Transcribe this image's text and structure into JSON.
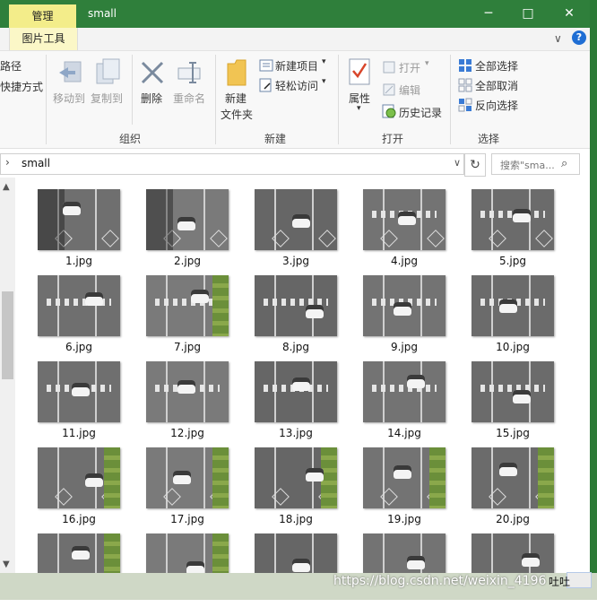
{
  "window": {
    "context_tab": "管理",
    "title": "small",
    "minimize_glyph": "─",
    "maximize_glyph": "□",
    "close_glyph": "✕"
  },
  "tabs": {
    "picture_tools": "图片工具",
    "collapse_glyph": "∨",
    "help_glyph": "?"
  },
  "ribbon": {
    "clipboard_partial": [
      "路径",
      "快捷方式"
    ],
    "organize": {
      "move_to": "移动到",
      "copy_to": "复制到",
      "delete": "删除",
      "rename": "重命名",
      "group_label": "组织"
    },
    "new": {
      "new_folder_line1": "新建",
      "new_folder_line2": "文件夹",
      "new_item": "新建项目",
      "easy_access": "轻松访问",
      "group_label": "新建"
    },
    "open": {
      "properties": "属性",
      "open": "打开",
      "edit": "编辑",
      "history": "历史记录",
      "group_label": "打开"
    },
    "select": {
      "select_all": "全部选择",
      "select_none": "全部取消",
      "invert": "反向选择",
      "group_label": "选择"
    }
  },
  "address": {
    "path": "small",
    "search_placeholder": "搜索\"sma...",
    "refresh_glyph": "↻",
    "search_glyph": "🔍"
  },
  "files": [
    {
      "name": "1.jpg"
    },
    {
      "name": "2.jpg"
    },
    {
      "name": "3.jpg"
    },
    {
      "name": "4.jpg"
    },
    {
      "name": "5.jpg"
    },
    {
      "name": "6.jpg"
    },
    {
      "name": "7.jpg"
    },
    {
      "name": "8.jpg"
    },
    {
      "name": "9.jpg"
    },
    {
      "name": "10.jpg"
    },
    {
      "name": "11.jpg"
    },
    {
      "name": "12.jpg"
    },
    {
      "name": "13.jpg"
    },
    {
      "name": "14.jpg"
    },
    {
      "name": "15.jpg"
    },
    {
      "name": "16.jpg"
    },
    {
      "name": "17.jpg"
    },
    {
      "name": "18.jpg"
    },
    {
      "name": "19.jpg"
    },
    {
      "name": "20.jpg"
    },
    {
      "name": ""
    },
    {
      "name": ""
    },
    {
      "name": ""
    },
    {
      "name": ""
    },
    {
      "name": ""
    }
  ],
  "watermark": "https://blog.csdn.net/weixin_4196",
  "watermark_tail": "吐吐",
  "colors": {
    "titlebar": "#2f7f3b",
    "context_tab": "#f3ed8a"
  }
}
